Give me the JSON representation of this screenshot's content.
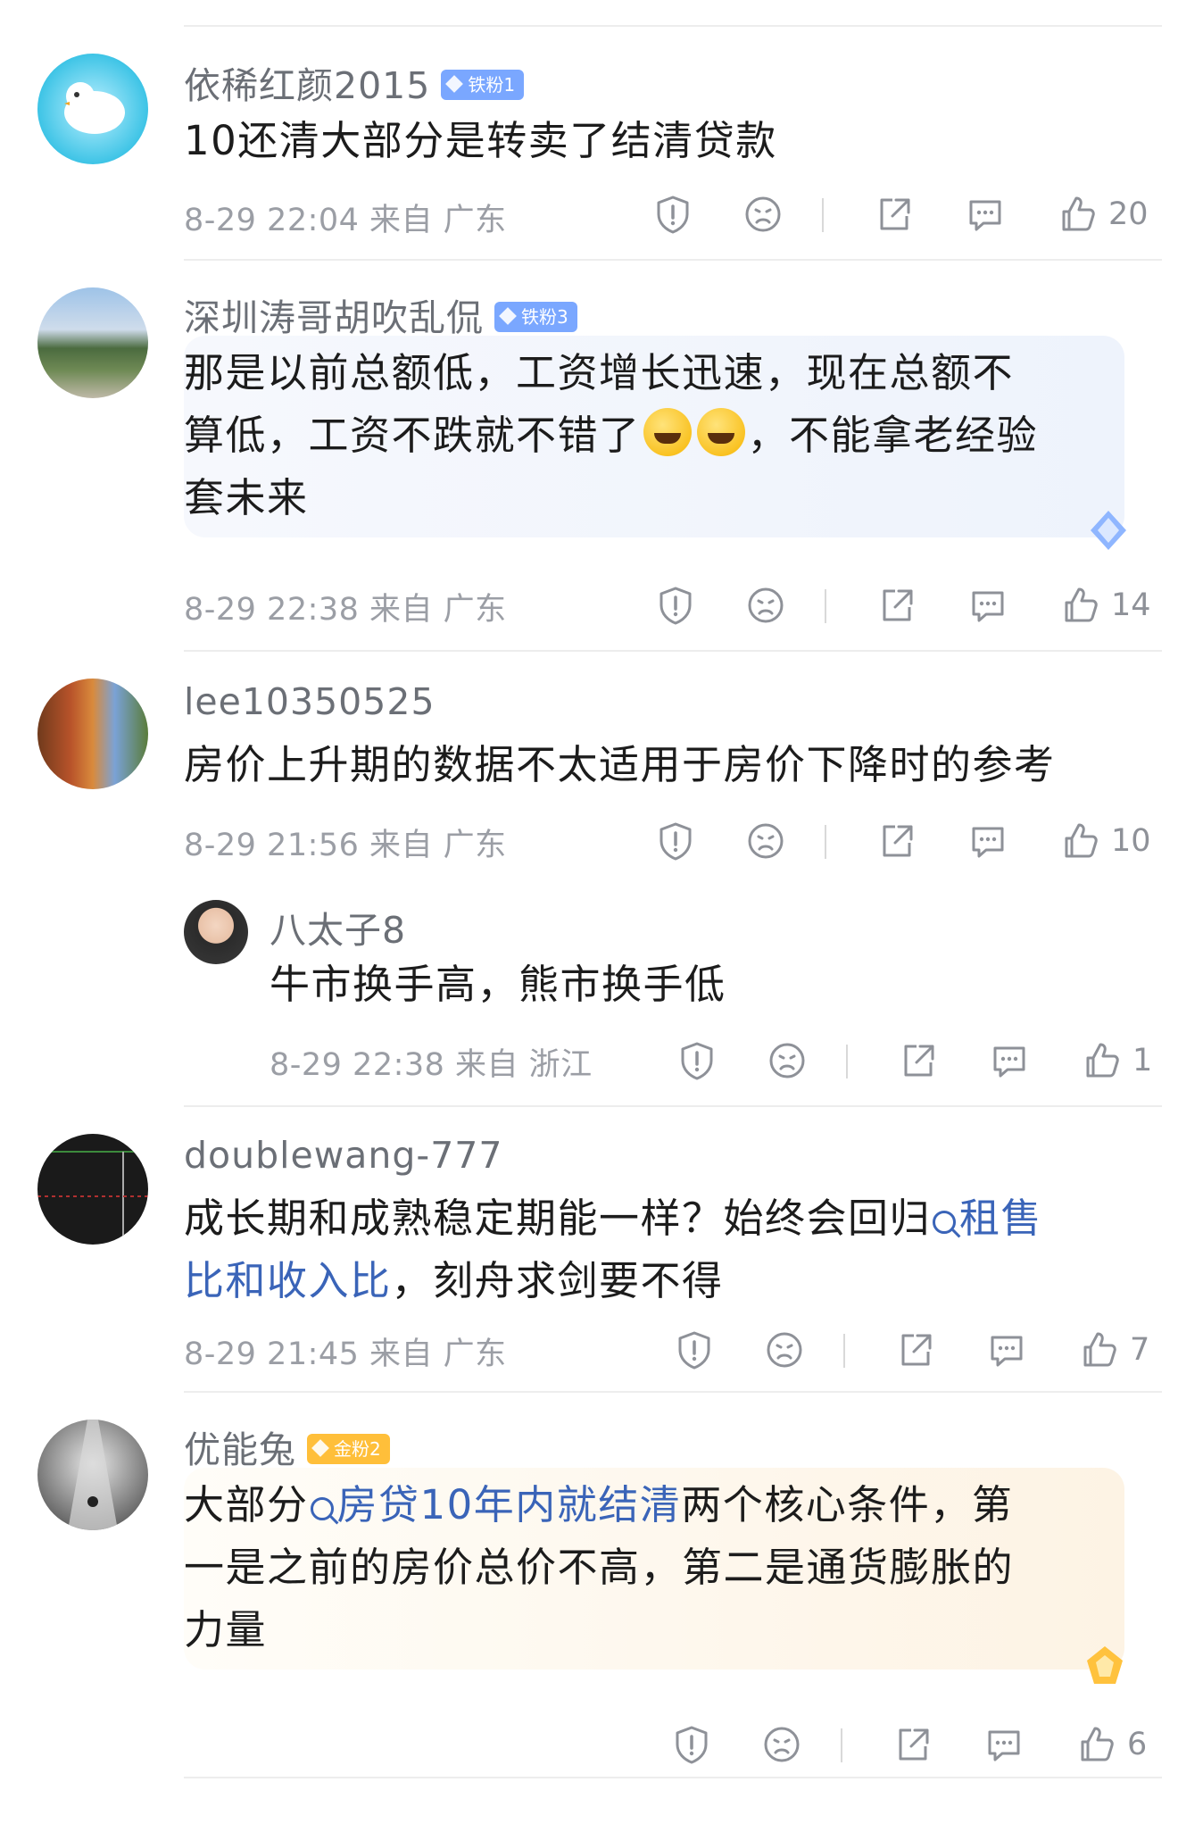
{
  "comments": [
    {
      "username": "依稀红颜2015",
      "badge": "铁粉1",
      "text": "10还清大部分是转卖了结清贷款",
      "meta": "8-29 22:04 来自 广东",
      "likes": "20"
    },
    {
      "username": "深圳涛哥胡吹乱侃",
      "badge": "铁粉3",
      "text_lines": [
        "那是以前总额低，工资增长迅速，现在总额不",
        "算低，工资不跌就不错了",
        "，不能拿老经验",
        "套未来"
      ],
      "meta": "8-29 22:38 来自 广东",
      "likes": "14"
    },
    {
      "username": "lee10350525",
      "text": "房价上升期的数据不太适用于房价下降时的参考",
      "meta": "8-29 21:56 来自 广东",
      "likes": "10",
      "reply": {
        "username": "八太子8",
        "text": "牛市换手高，熊市换手低",
        "meta": "8-29 22:38 来自 浙江",
        "likes": "1"
      }
    },
    {
      "username": "doublewang-777",
      "text_before": "成长期和成熟稳定期能一样？始终会回归",
      "link": "租售",
      "link_cont": "比和收入比",
      "text_after": "，刻舟求剑要不得",
      "meta": "8-29 21:45 来自 广东",
      "likes": "7"
    },
    {
      "username": "优能兔",
      "badge": "金粉2",
      "text_before": "大部分",
      "link": "房贷10年内就结清",
      "text_after": "两个核心条件，第",
      "text_line2": "一是之前的房价总价不高，第二是通货膨胀的",
      "text_line3": "力量",
      "likes": "6"
    }
  ],
  "icons": {
    "report": "report-icon",
    "dislike": "dislike-face-icon",
    "share": "share-icon",
    "reply": "comment-icon",
    "like": "thumbs-up-icon"
  },
  "colors": {
    "link": "#3a64b8",
    "meta": "#9b9ea5",
    "badge_blue": "#7aa7ff",
    "badge_gold": "#ffbf3a"
  }
}
